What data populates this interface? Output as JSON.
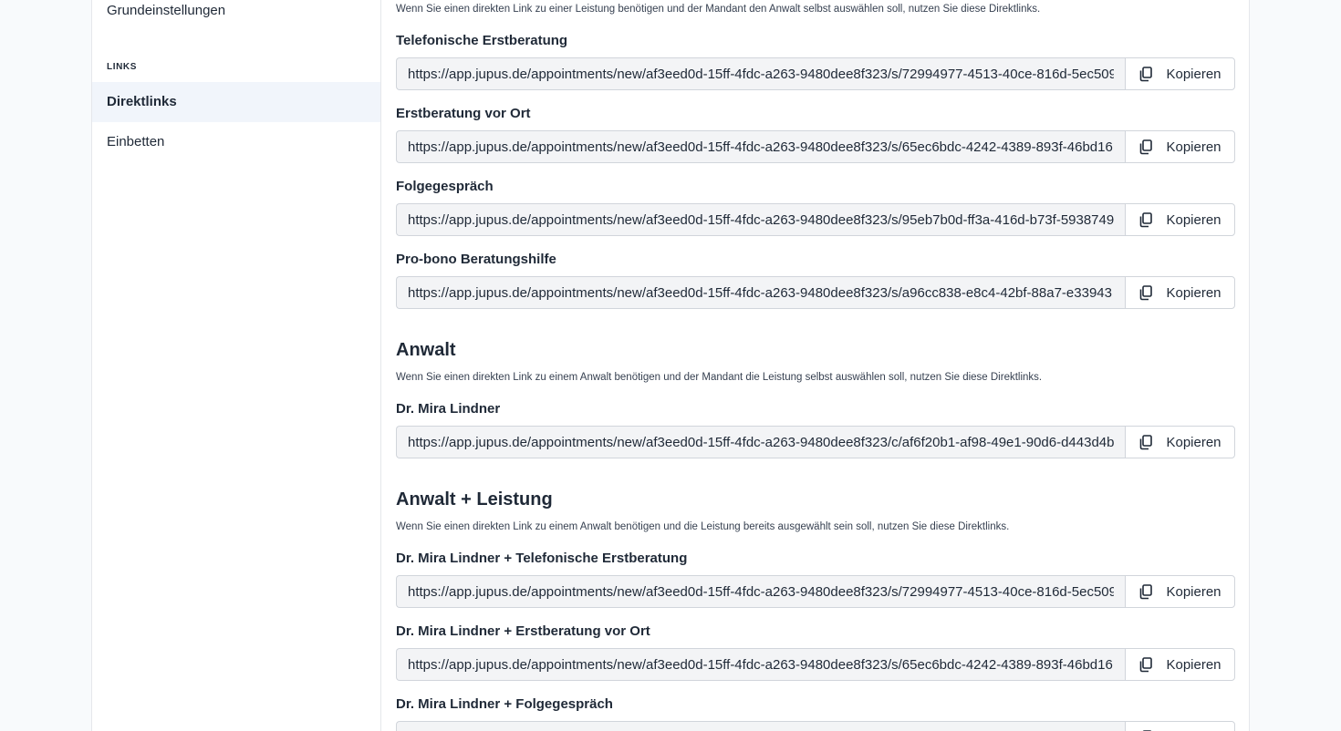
{
  "sidebar": {
    "top_item": "Grundeinstellungen",
    "section_label": "LINKS",
    "items": [
      {
        "label": "Direktlinks",
        "active": true
      },
      {
        "label": "Einbetten",
        "active": false
      }
    ]
  },
  "copy_label": "Kopieren",
  "icons": {
    "copy": "copy-icon"
  },
  "sections": {
    "leistung": {
      "description": "Wenn Sie einen direkten Link zu einer Leistung benötigen und der Mandant den Anwalt selbst auswählen soll, nutzen Sie diese Direktlinks.",
      "links": [
        {
          "label": "Telefonische Erstberatung",
          "url": "https://app.jupus.de/appointments/new/af3eed0d-15ff-4fdc-a263-9480dee8f323/s/72994977-4513-40ce-816d-5ec509"
        },
        {
          "label": "Erstberatung vor Ort",
          "url": "https://app.jupus.de/appointments/new/af3eed0d-15ff-4fdc-a263-9480dee8f323/s/65ec6bdc-4242-4389-893f-46bd16"
        },
        {
          "label": "Folgegespräch",
          "url": "https://app.jupus.de/appointments/new/af3eed0d-15ff-4fdc-a263-9480dee8f323/s/95eb7b0d-ff3a-416d-b73f-5938749"
        },
        {
          "label": "Pro-bono Beratungshilfe",
          "url": "https://app.jupus.de/appointments/new/af3eed0d-15ff-4fdc-a263-9480dee8f323/s/a96cc838-e8c4-42bf-88a7-e33943"
        }
      ]
    },
    "anwalt": {
      "title": "Anwalt",
      "description": "Wenn Sie einen direkten Link zu einem Anwalt benötigen und der Mandant die Leistung selbst auswählen soll, nutzen Sie diese Direktlinks.",
      "links": [
        {
          "label": "Dr. Mira Lindner",
          "url": "https://app.jupus.de/appointments/new/af3eed0d-15ff-4fdc-a263-9480dee8f323/c/af6f20b1-af98-49e1-90d6-d443d4b"
        }
      ]
    },
    "anwalt_leistung": {
      "title": "Anwalt + Leistung",
      "description": "Wenn Sie einen direkten Link zu einem Anwalt benötigen und die Leistung bereits ausgewählt sein soll, nutzen Sie diese Direktlinks.",
      "links": [
        {
          "label": "Dr. Mira Lindner + Telefonische Erstberatung",
          "url": "https://app.jupus.de/appointments/new/af3eed0d-15ff-4fdc-a263-9480dee8f323/s/72994977-4513-40ce-816d-5ec509"
        },
        {
          "label": "Dr. Mira Lindner + Erstberatung vor Ort",
          "url": "https://app.jupus.de/appointments/new/af3eed0d-15ff-4fdc-a263-9480dee8f323/s/65ec6bdc-4242-4389-893f-46bd16"
        },
        {
          "label": "Dr. Mira Lindner + Folgegespräch",
          "url": ""
        }
      ]
    }
  }
}
